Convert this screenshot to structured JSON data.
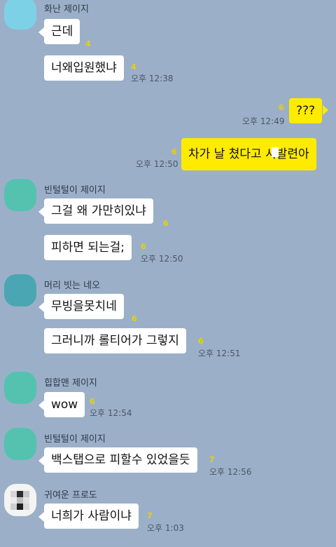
{
  "colors": {
    "background": "#9bb0c8",
    "bubble_in": "#ffffff",
    "bubble_out": "#ffeb00",
    "unread": "#e8d200",
    "avatar_cyan": "#7dd1e6",
    "avatar_teal": "#55c2b0",
    "avatar_dark_teal": "#4aa6b3"
  },
  "chat": {
    "group1": {
      "sender": "화난 제이지",
      "msg1": "근데",
      "unread1": "4",
      "msg2": "너왜입원했냐",
      "unread2": "4",
      "time": "오후 12:38"
    },
    "me1": {
      "msg": "???",
      "unread": "6",
      "time": "오후 12:49"
    },
    "me2": {
      "msg": "차가 날 쳤다고 시발련아",
      "unread": "6",
      "time": "오후 12:50"
    },
    "group2": {
      "sender": "빈털털이 제이지",
      "msg1": "그걸 왜 가만히있냐",
      "unread1": "6",
      "msg2": "피하면 되는걸;",
      "unread2": "6",
      "time": "오후 12:50"
    },
    "group3": {
      "sender": "머리 빗는 네오",
      "msg1": "무빙을못치네",
      "unread1": "6",
      "msg2": "그러니까 롤티어가 그렇지",
      "unread2": "6",
      "time": "오후 12:51"
    },
    "group4": {
      "sender": "힙합맨 제이지",
      "msg1": "wow",
      "unread1": "6",
      "time": "오후 12:54"
    },
    "group5": {
      "sender": "빈털털이 제이지",
      "msg1": "백스탭으로 피할수 있었을듯",
      "unread1": "7",
      "time": "오후 12:56"
    },
    "group6": {
      "sender": "귀여운 프로도",
      "msg1": "너희가 사람이냐",
      "unread1": "7",
      "time": "오후 1:03"
    }
  }
}
